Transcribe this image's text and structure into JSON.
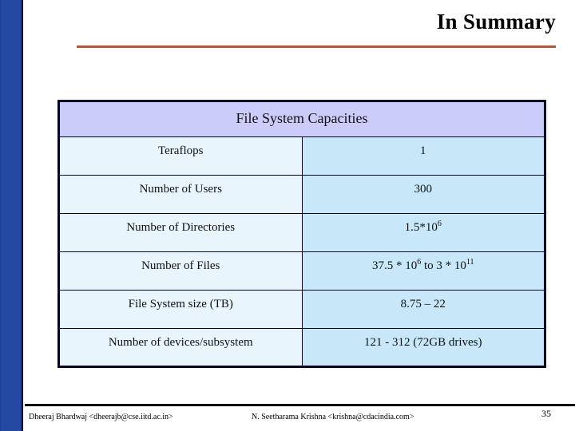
{
  "slide": {
    "title": "In Summary",
    "page_number": "35",
    "accent_rule_color": "#b5553a",
    "left_bar_color": "#2449a3",
    "header_fill": "#ccccfa",
    "label_fill": "#e8f5fc",
    "value_fill": "#c8e8fa"
  },
  "table": {
    "caption": "File System Capacities",
    "rows": [
      {
        "label": "Teraflops",
        "value": "1"
      },
      {
        "label": "Number of  Users",
        "value": "300"
      },
      {
        "label": "Number of Directories",
        "value": "1.5*10",
        "value_sup": "6"
      },
      {
        "label": "Number of Files",
        "value_pre": "37.5 * 10",
        "value_sup": "6",
        "value_mid": " to 3 * 10",
        "value_sup2": "11"
      },
      {
        "label": "File System size (TB)",
        "value": "8.75 – 22"
      },
      {
        "label": "Number of devices/subsystem",
        "value": "121 - 312  (72GB drives)"
      }
    ]
  },
  "footer": {
    "author_left": "Dheeraj Bhardwaj <dheerajb@cse.iitd.ac.in>",
    "author_center": "N. Seetharama Krishna <krishna@cdacindia.com>"
  }
}
